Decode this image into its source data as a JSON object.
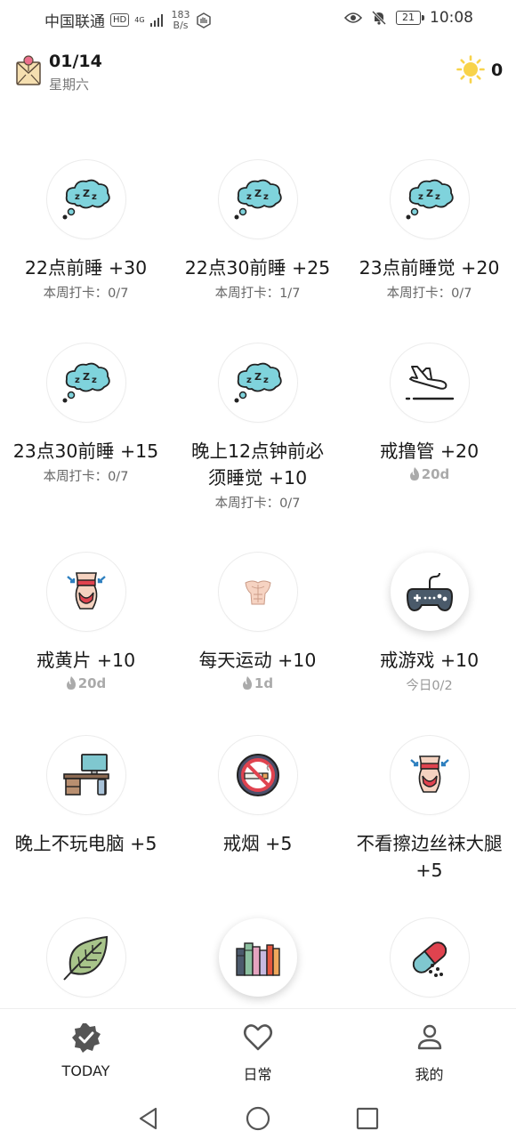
{
  "status_bar": {
    "carrier": "中国联通",
    "hd": "HD",
    "network": "4G",
    "speed_value": "183",
    "speed_unit": "B/s",
    "battery": "21",
    "time": "10:08"
  },
  "header": {
    "date": "01/14",
    "weekday": "星期六",
    "points": "0"
  },
  "habits": [
    {
      "title": "22点前睡 +30",
      "sub": "本周打卡：0/7",
      "icon": "sleep-cloud-icon"
    },
    {
      "title": "22点30前睡 +25",
      "sub": "本周打卡：1/7",
      "icon": "sleep-cloud-icon"
    },
    {
      "title": "23点前睡觉 +20",
      "sub": "本周打卡：0/7",
      "icon": "sleep-cloud-icon"
    },
    {
      "title": "23点30前睡 +15",
      "sub": "本周打卡：0/7",
      "icon": "sleep-cloud-icon"
    },
    {
      "title": "晚上12点钟前必须睡觉 +10",
      "sub": "本周打卡：0/7",
      "icon": "sleep-cloud-icon"
    },
    {
      "title": "戒撸管 +20",
      "sub": "20d",
      "icon": "plane-landing-icon"
    },
    {
      "title": "戒黄片 +10",
      "sub": "20d",
      "icon": "waist-icon"
    },
    {
      "title": "每天运动 +10",
      "sub": "1d",
      "icon": "muscle-torso-icon"
    },
    {
      "title": "戒游戏 +10",
      "sub": "今日0/2",
      "icon": "gamepad-icon"
    },
    {
      "title": "晚上不玩电脑 +5",
      "sub": "",
      "icon": "computer-desk-icon"
    },
    {
      "title": "戒烟 +5",
      "sub": "",
      "icon": "no-smoking-icon"
    },
    {
      "title": "不看擦边丝袜大腿 +5",
      "sub": "",
      "icon": "waist-icon"
    },
    {
      "title": "",
      "sub": "",
      "icon": "leaf-icon"
    },
    {
      "title": "",
      "sub": "",
      "icon": "books-icon"
    },
    {
      "title": "",
      "sub": "",
      "icon": "pill-icon"
    }
  ],
  "nav": {
    "today": "TODAY",
    "daily": "日常",
    "mine": "我的"
  },
  "colors": {
    "cloud": "#7fd3dc",
    "accent_red": "#e0434f",
    "streak_gray": "#aaaaaa"
  }
}
